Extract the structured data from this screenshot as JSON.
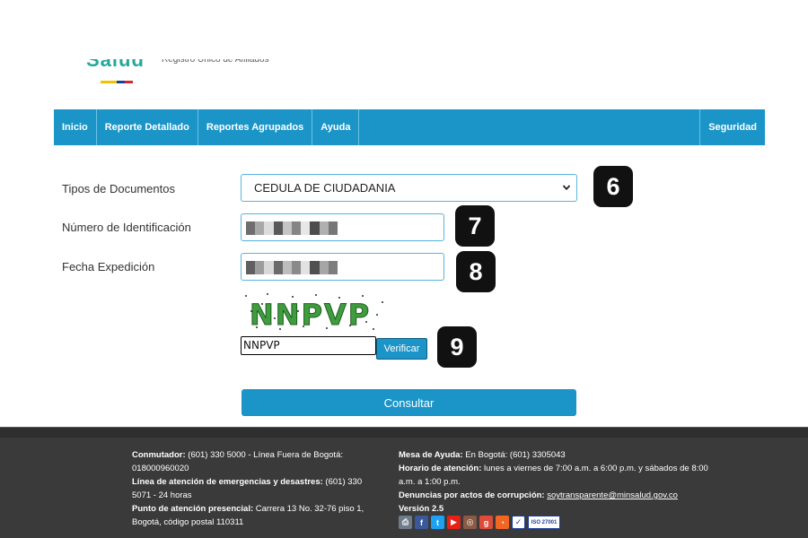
{
  "header": {
    "logo_text": "Salud",
    "subtitle": "Registro Único de Afiliados"
  },
  "nav": {
    "items": [
      "Inicio",
      "Reporte Detallado",
      "Reportes Agrupados",
      "Ayuda"
    ],
    "right_item": "Seguridad"
  },
  "form": {
    "doc_type_label": "Tipos de Documentos",
    "doc_type_value": "CEDULA DE CIUDADANIA",
    "id_label": "Número de Identificación",
    "date_label": "Fecha Expedición",
    "captcha_text": "NNPVP",
    "captcha_input_value": "NNPVP",
    "verify_label": "Verificar",
    "consult_label": "Consultar"
  },
  "badges": [
    "6",
    "7",
    "8",
    "9"
  ],
  "footer": {
    "conmutador_label": "Conmutador:",
    "conmutador_text": " (601) 330 5000 - Línea Fuera de Bogotá: 018000960020",
    "emergencias_label": "Línea de atención de emergencias y desastres:",
    "emergencias_text": " (601) 330 5071 - 24 horas",
    "presencial_label": "Punto de atención presencial:",
    "presencial_text": " Carrera 13 No. 32-76 piso 1, Bogotá, código postal 110311",
    "mesa_label": "Mesa de Ayuda:",
    "mesa_text": " En Bogotá: (601) 3305043",
    "horario_label": "Horario de atención:",
    "horario_text": " lunes a viernes de 7:00 a.m. a 6:00 p.m. y sábados de 8:00 a.m. a 1:00 p.m.",
    "denuncias_label": "Denuncias por actos de corrupción:",
    "denuncias_email": "soytransparente@minsalud.gov.co",
    "version": "Versión 2.5",
    "iso_label": "ISO 27001"
  },
  "colors": {
    "primary": "#1b95c8",
    "footer_bg": "#3a3a3a"
  }
}
